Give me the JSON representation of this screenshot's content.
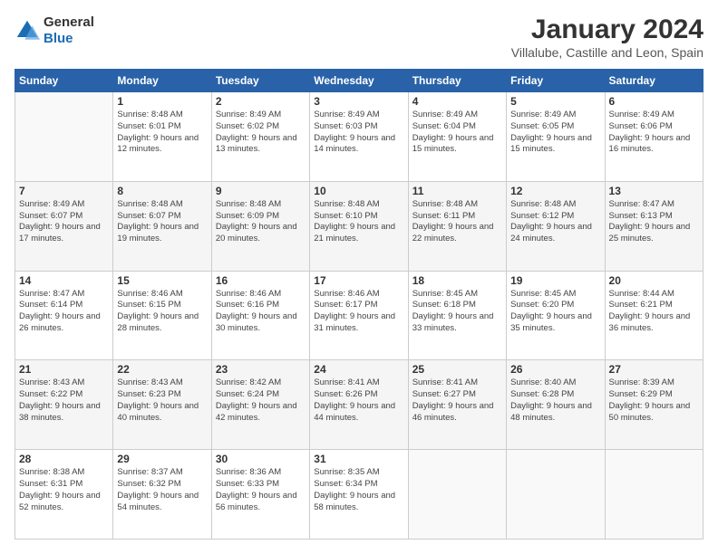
{
  "logo": {
    "general": "General",
    "blue": "Blue"
  },
  "title": "January 2024",
  "location": "Villalube, Castille and Leon, Spain",
  "days": [
    "Sunday",
    "Monday",
    "Tuesday",
    "Wednesday",
    "Thursday",
    "Friday",
    "Saturday"
  ],
  "weeks": [
    [
      {
        "num": "",
        "sunrise": "",
        "sunset": "",
        "daylight": ""
      },
      {
        "num": "1",
        "sunrise": "Sunrise: 8:48 AM",
        "sunset": "Sunset: 6:01 PM",
        "daylight": "Daylight: 9 hours and 12 minutes."
      },
      {
        "num": "2",
        "sunrise": "Sunrise: 8:49 AM",
        "sunset": "Sunset: 6:02 PM",
        "daylight": "Daylight: 9 hours and 13 minutes."
      },
      {
        "num": "3",
        "sunrise": "Sunrise: 8:49 AM",
        "sunset": "Sunset: 6:03 PM",
        "daylight": "Daylight: 9 hours and 14 minutes."
      },
      {
        "num": "4",
        "sunrise": "Sunrise: 8:49 AM",
        "sunset": "Sunset: 6:04 PM",
        "daylight": "Daylight: 9 hours and 15 minutes."
      },
      {
        "num": "5",
        "sunrise": "Sunrise: 8:49 AM",
        "sunset": "Sunset: 6:05 PM",
        "daylight": "Daylight: 9 hours and 15 minutes."
      },
      {
        "num": "6",
        "sunrise": "Sunrise: 8:49 AM",
        "sunset": "Sunset: 6:06 PM",
        "daylight": "Daylight: 9 hours and 16 minutes."
      }
    ],
    [
      {
        "num": "7",
        "sunrise": "Sunrise: 8:49 AM",
        "sunset": "Sunset: 6:07 PM",
        "daylight": "Daylight: 9 hours and 17 minutes."
      },
      {
        "num": "8",
        "sunrise": "Sunrise: 8:48 AM",
        "sunset": "Sunset: 6:07 PM",
        "daylight": "Daylight: 9 hours and 19 minutes."
      },
      {
        "num": "9",
        "sunrise": "Sunrise: 8:48 AM",
        "sunset": "Sunset: 6:09 PM",
        "daylight": "Daylight: 9 hours and 20 minutes."
      },
      {
        "num": "10",
        "sunrise": "Sunrise: 8:48 AM",
        "sunset": "Sunset: 6:10 PM",
        "daylight": "Daylight: 9 hours and 21 minutes."
      },
      {
        "num": "11",
        "sunrise": "Sunrise: 8:48 AM",
        "sunset": "Sunset: 6:11 PM",
        "daylight": "Daylight: 9 hours and 22 minutes."
      },
      {
        "num": "12",
        "sunrise": "Sunrise: 8:48 AM",
        "sunset": "Sunset: 6:12 PM",
        "daylight": "Daylight: 9 hours and 24 minutes."
      },
      {
        "num": "13",
        "sunrise": "Sunrise: 8:47 AM",
        "sunset": "Sunset: 6:13 PM",
        "daylight": "Daylight: 9 hours and 25 minutes."
      }
    ],
    [
      {
        "num": "14",
        "sunrise": "Sunrise: 8:47 AM",
        "sunset": "Sunset: 6:14 PM",
        "daylight": "Daylight: 9 hours and 26 minutes."
      },
      {
        "num": "15",
        "sunrise": "Sunrise: 8:46 AM",
        "sunset": "Sunset: 6:15 PM",
        "daylight": "Daylight: 9 hours and 28 minutes."
      },
      {
        "num": "16",
        "sunrise": "Sunrise: 8:46 AM",
        "sunset": "Sunset: 6:16 PM",
        "daylight": "Daylight: 9 hours and 30 minutes."
      },
      {
        "num": "17",
        "sunrise": "Sunrise: 8:46 AM",
        "sunset": "Sunset: 6:17 PM",
        "daylight": "Daylight: 9 hours and 31 minutes."
      },
      {
        "num": "18",
        "sunrise": "Sunrise: 8:45 AM",
        "sunset": "Sunset: 6:18 PM",
        "daylight": "Daylight: 9 hours and 33 minutes."
      },
      {
        "num": "19",
        "sunrise": "Sunrise: 8:45 AM",
        "sunset": "Sunset: 6:20 PM",
        "daylight": "Daylight: 9 hours and 35 minutes."
      },
      {
        "num": "20",
        "sunrise": "Sunrise: 8:44 AM",
        "sunset": "Sunset: 6:21 PM",
        "daylight": "Daylight: 9 hours and 36 minutes."
      }
    ],
    [
      {
        "num": "21",
        "sunrise": "Sunrise: 8:43 AM",
        "sunset": "Sunset: 6:22 PM",
        "daylight": "Daylight: 9 hours and 38 minutes."
      },
      {
        "num": "22",
        "sunrise": "Sunrise: 8:43 AM",
        "sunset": "Sunset: 6:23 PM",
        "daylight": "Daylight: 9 hours and 40 minutes."
      },
      {
        "num": "23",
        "sunrise": "Sunrise: 8:42 AM",
        "sunset": "Sunset: 6:24 PM",
        "daylight": "Daylight: 9 hours and 42 minutes."
      },
      {
        "num": "24",
        "sunrise": "Sunrise: 8:41 AM",
        "sunset": "Sunset: 6:26 PM",
        "daylight": "Daylight: 9 hours and 44 minutes."
      },
      {
        "num": "25",
        "sunrise": "Sunrise: 8:41 AM",
        "sunset": "Sunset: 6:27 PM",
        "daylight": "Daylight: 9 hours and 46 minutes."
      },
      {
        "num": "26",
        "sunrise": "Sunrise: 8:40 AM",
        "sunset": "Sunset: 6:28 PM",
        "daylight": "Daylight: 9 hours and 48 minutes."
      },
      {
        "num": "27",
        "sunrise": "Sunrise: 8:39 AM",
        "sunset": "Sunset: 6:29 PM",
        "daylight": "Daylight: 9 hours and 50 minutes."
      }
    ],
    [
      {
        "num": "28",
        "sunrise": "Sunrise: 8:38 AM",
        "sunset": "Sunset: 6:31 PM",
        "daylight": "Daylight: 9 hours and 52 minutes."
      },
      {
        "num": "29",
        "sunrise": "Sunrise: 8:37 AM",
        "sunset": "Sunset: 6:32 PM",
        "daylight": "Daylight: 9 hours and 54 minutes."
      },
      {
        "num": "30",
        "sunrise": "Sunrise: 8:36 AM",
        "sunset": "Sunset: 6:33 PM",
        "daylight": "Daylight: 9 hours and 56 minutes."
      },
      {
        "num": "31",
        "sunrise": "Sunrise: 8:35 AM",
        "sunset": "Sunset: 6:34 PM",
        "daylight": "Daylight: 9 hours and 58 minutes."
      },
      {
        "num": "",
        "sunrise": "",
        "sunset": "",
        "daylight": ""
      },
      {
        "num": "",
        "sunrise": "",
        "sunset": "",
        "daylight": ""
      },
      {
        "num": "",
        "sunrise": "",
        "sunset": "",
        "daylight": ""
      }
    ]
  ]
}
